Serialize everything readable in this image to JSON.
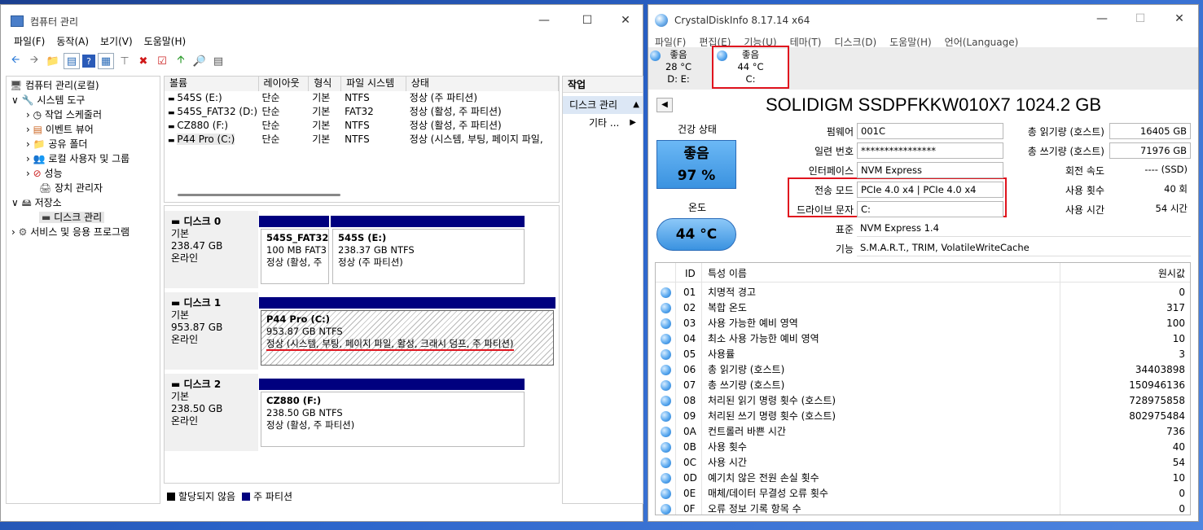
{
  "left": {
    "title": "컴퓨터 관리",
    "menu": [
      "파일(F)",
      "동작(A)",
      "보기(V)",
      "도움말(H)"
    ],
    "tree": {
      "root": "컴퓨터 관리(로컬)",
      "system_tools": "시스템 도구",
      "task_scheduler": "작업 스케줄러",
      "event_viewer": "이벤트 뷰어",
      "shared_folders": "공유 폴더",
      "local_users": "로컬 사용자 및 그룹",
      "performance": "성능",
      "device_manager": "장치 관리자",
      "storage": "저장소",
      "disk_management": "디스크 관리",
      "services_apps": "서비스 및 응용 프로그램"
    },
    "columns": [
      "볼륨",
      "레이아웃",
      "형식",
      "파일 시스템",
      "상태"
    ],
    "volumes": [
      {
        "name": "545S (E:)",
        "layout": "단순",
        "type": "기본",
        "fs": "NTFS",
        "status": "정상 (주 파티션)"
      },
      {
        "name": "545S_FAT32 (D:)",
        "layout": "단순",
        "type": "기본",
        "fs": "FAT32",
        "status": "정상 (활성, 주 파티션)"
      },
      {
        "name": "CZ880 (F:)",
        "layout": "단순",
        "type": "기본",
        "fs": "NTFS",
        "status": "정상 (활성, 주 파티션)"
      },
      {
        "name": "P44 Pro (C:)",
        "layout": "단순",
        "type": "기본",
        "fs": "NTFS",
        "status": "정상 (시스템, 부팅, 페이지 파일,"
      }
    ],
    "actions": {
      "header": "작업",
      "item": "디스크 관리",
      "more": "기타 ..."
    },
    "disks": [
      {
        "name": "디스크 0",
        "type": "기본",
        "size": "238.47 GB",
        "state": "온라인",
        "parts": [
          {
            "title": "545S_FAT32",
            "size": "100 MB FAT3",
            "status": "정상 (활성, 주"
          },
          {
            "title": "545S  (E:)",
            "size": "238.37 GB NTFS",
            "status": "정상 (주 파티션)"
          }
        ]
      },
      {
        "name": "디스크 1",
        "type": "기본",
        "size": "953.87 GB",
        "state": "온라인",
        "parts": [
          {
            "title": "P44 Pro  (C:)",
            "size": "953.87 GB NTFS",
            "status": "정상 (시스템, 부팅, 페이지 파일, 활성, 크래시 덤프, 주 파티션)"
          }
        ]
      },
      {
        "name": "디스크 2",
        "type": "기본",
        "size": "238.50 GB",
        "state": "온라인",
        "parts": [
          {
            "title": "CZ880  (F:)",
            "size": "238.50 GB NTFS",
            "status": "정상 (활성, 주 파티션)"
          }
        ]
      }
    ],
    "legend": {
      "unallocated": "할당되지 않음",
      "primary": "주 파티션"
    }
  },
  "right": {
    "title": "CrystalDiskInfo 8.17.14 x64",
    "menu": [
      "파일(F)",
      "편집(E)",
      "기능(U)",
      "테마(T)",
      "디스크(D)",
      "도움말(H)",
      "언어(Language)"
    ],
    "drive_tabs": [
      {
        "health": "좋음",
        "temp": "28 °C",
        "letter": "D: E:"
      },
      {
        "health": "좋음",
        "temp": "44 °C",
        "letter": "C:"
      }
    ],
    "model": "SOLIDIGM SSDPFKKW010X7 1024.2 GB",
    "health_label": "건강 상태",
    "health_status": "좋음",
    "health_pct": "97 %",
    "temp_label": "온도",
    "temp_value": "44 °C",
    "fields": [
      {
        "label": "펌웨어",
        "value": "001C"
      },
      {
        "label": "일련 번호",
        "value": "****************"
      },
      {
        "label": "인터페이스",
        "value": "NVM Express"
      },
      {
        "label": "전송 모드",
        "value": "PCIe 4.0 x4 | PCIe 4.0 x4"
      },
      {
        "label": "드라이브 문자",
        "value": "C:"
      },
      {
        "label": "표준",
        "value": "NVM Express 1.4"
      },
      {
        "label": "기능",
        "value": "S.M.A.R.T., TRIM, VolatileWriteCache"
      }
    ],
    "right_fields": [
      {
        "label": "총 읽기량 (호스트)",
        "value": "16405 GB"
      },
      {
        "label": "총 쓰기량 (호스트)",
        "value": "71976 GB"
      },
      {
        "label": "회전 속도",
        "value": "---- (SSD)"
      },
      {
        "label": "사용 횟수",
        "value": "40 회"
      },
      {
        "label": "사용 시간",
        "value": "54 시간"
      }
    ],
    "smart_headers": {
      "id": "ID",
      "name": "특성 이름",
      "raw": "원시값"
    },
    "smart": [
      {
        "id": "01",
        "name": "치명적 경고",
        "raw": "0"
      },
      {
        "id": "02",
        "name": "복합 온도",
        "raw": "317"
      },
      {
        "id": "03",
        "name": "사용 가능한 예비 영역",
        "raw": "100"
      },
      {
        "id": "04",
        "name": "최소 사용 가능한 예비 영역",
        "raw": "10"
      },
      {
        "id": "05",
        "name": "사용률",
        "raw": "3"
      },
      {
        "id": "06",
        "name": "총 읽기량 (호스트)",
        "raw": "34403898"
      },
      {
        "id": "07",
        "name": "총 쓰기량 (호스트)",
        "raw": "150946136"
      },
      {
        "id": "08",
        "name": "처리된 읽기 명령 횟수 (호스트)",
        "raw": "728975858"
      },
      {
        "id": "09",
        "name": "처리된 쓰기 명령 횟수 (호스트)",
        "raw": "802975484"
      },
      {
        "id": "0A",
        "name": "컨트롤러 바쁜 시간",
        "raw": "736"
      },
      {
        "id": "0B",
        "name": "사용 횟수",
        "raw": "40"
      },
      {
        "id": "0C",
        "name": "사용 시간",
        "raw": "54"
      },
      {
        "id": "0D",
        "name": "예기치 않은 전원 손실 횟수",
        "raw": "10"
      },
      {
        "id": "0E",
        "name": "매체/데이터 무결성 오류 횟수",
        "raw": "0"
      },
      {
        "id": "0F",
        "name": "오류 정보 기록 항목 수",
        "raw": "0"
      }
    ]
  },
  "colors": {
    "accent": "#00007f",
    "health_box": "#4aa3ef",
    "highlight": "#e0141e"
  }
}
